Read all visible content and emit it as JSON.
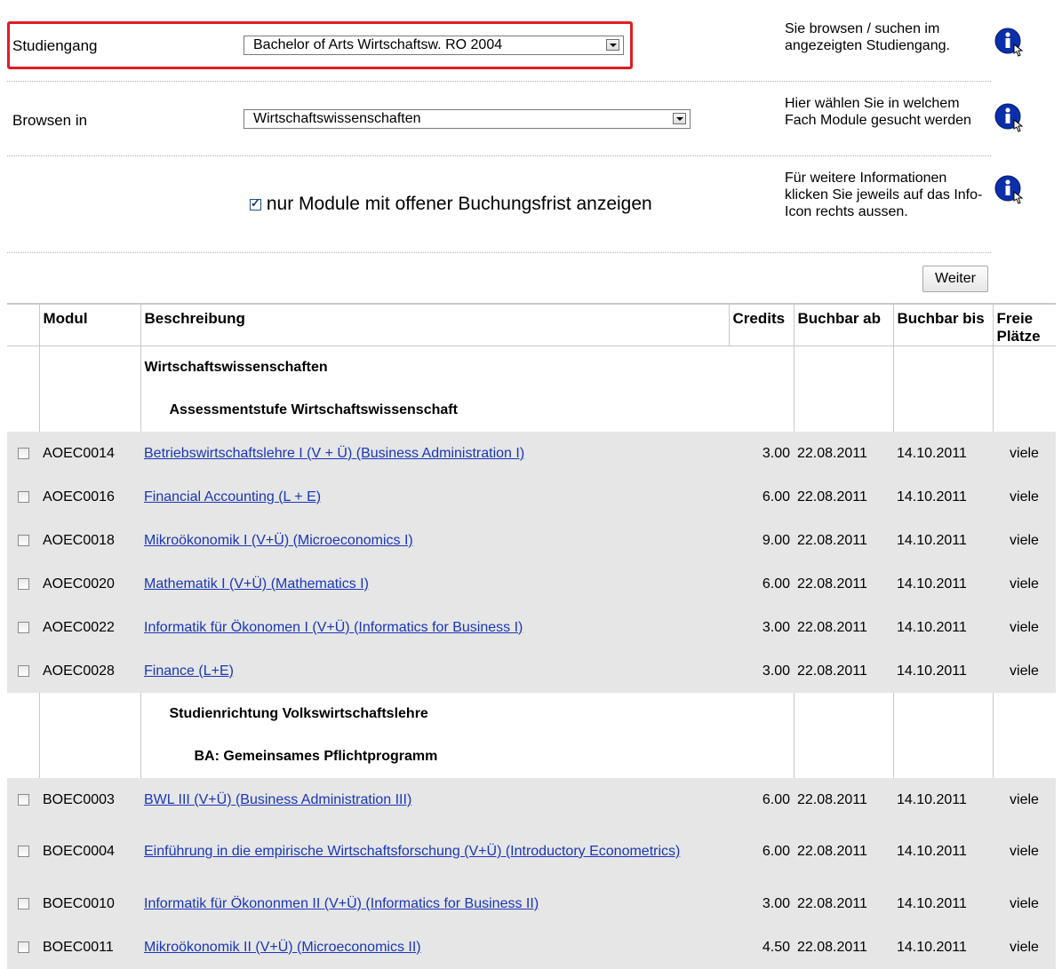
{
  "form": {
    "studiengang_label": "Studiengang",
    "studiengang_value": "Bachelor of Arts Wirtschaftsw. RO 2004",
    "studiengang_help": "Sie browsen / suchen im angezeigten Studiengang.",
    "browse_label": "Browsen in",
    "browse_value": "Wirtschaftswissenschaften",
    "browse_help": "Hier wählen Sie in welchem Fach Module gesucht werden",
    "filter_label": "nur Module mit offener Buchungsfrist anzeigen",
    "filter_checked": true,
    "filter_help": "Für weitere Informationen klicken Sie jeweils auf das Info-Icon rechts aussen.",
    "weiter_button": "Weiter",
    "info_icon": "info-cursor-icon",
    "highlight_color": "#e31b23"
  },
  "table": {
    "headers": {
      "modul": "Modul",
      "beschreibung": "Beschreibung",
      "credits": "Credits",
      "buchbar_ab": "Buchbar ab",
      "buchbar_bis": "Buchbar bis",
      "freie_plaetze": "Freie Plätze"
    },
    "group1": {
      "title": "Wirtschaftswissenschaften",
      "subtitle": "Assessmentstufe Wirtschaftswissenschaft"
    },
    "rows1": [
      {
        "code": "AOEC0014",
        "desc": "Betriebswirtschaftslehre I (V + Ü) (Business Administration I)",
        "credits": "3.00",
        "ab": "22.08.2011",
        "bis": "14.10.2011",
        "plaetze": "viele"
      },
      {
        "code": "AOEC0016",
        "desc": "Financial Accounting (L + E)",
        "credits": "6.00",
        "ab": "22.08.2011",
        "bis": "14.10.2011",
        "plaetze": "viele"
      },
      {
        "code": "AOEC0018",
        "desc": "Mikroökonomik I (V+Ü) (Microeconomics I)",
        "credits": "9.00",
        "ab": "22.08.2011",
        "bis": "14.10.2011",
        "plaetze": "viele"
      },
      {
        "code": "AOEC0020",
        "desc": "Mathematik I (V+Ü) (Mathematics I)",
        "credits": "6.00",
        "ab": "22.08.2011",
        "bis": "14.10.2011",
        "plaetze": "viele"
      },
      {
        "code": "AOEC0022",
        "desc": "Informatik für Ökonomen I (V+Ü) (Informatics for Business I)",
        "credits": "3.00",
        "ab": "22.08.2011",
        "bis": "14.10.2011",
        "plaetze": "viele"
      },
      {
        "code": "AOEC0028",
        "desc": "Finance (L+E)",
        "credits": "3.00",
        "ab": "22.08.2011",
        "bis": "14.10.2011",
        "plaetze": "viele"
      }
    ],
    "group2": {
      "title": "Studienrichtung Volkswirtschaftslehre",
      "subtitle": "BA: Gemeinsames Pflichtprogramm"
    },
    "rows2": [
      {
        "code": "BOEC0003",
        "desc": "BWL III (V+Ü) (Business Administration III)",
        "credits": "6.00",
        "ab": "22.08.2011",
        "bis": "14.10.2011",
        "plaetze": "viele"
      },
      {
        "code": "BOEC0004",
        "desc": "Einführung in die empirische Wirtschaftsforschung (V+Ü) (Introductory Econometrics)",
        "credits": "6.00",
        "ab": "22.08.2011",
        "bis": "14.10.2011",
        "plaetze": "viele"
      },
      {
        "code": "BOEC0010",
        "desc": "Informatik für Ökononmen II (V+Ü) (Informatics for Business II)",
        "credits": "3.00",
        "ab": "22.08.2011",
        "bis": "14.10.2011",
        "plaetze": "viele"
      },
      {
        "code": "BOEC0011",
        "desc": "Mikroökonomik II (V+Ü) (Microeconomics II)",
        "credits": "4.50",
        "ab": "22.08.2011",
        "bis": "14.10.2011",
        "plaetze": "viele"
      }
    ]
  }
}
